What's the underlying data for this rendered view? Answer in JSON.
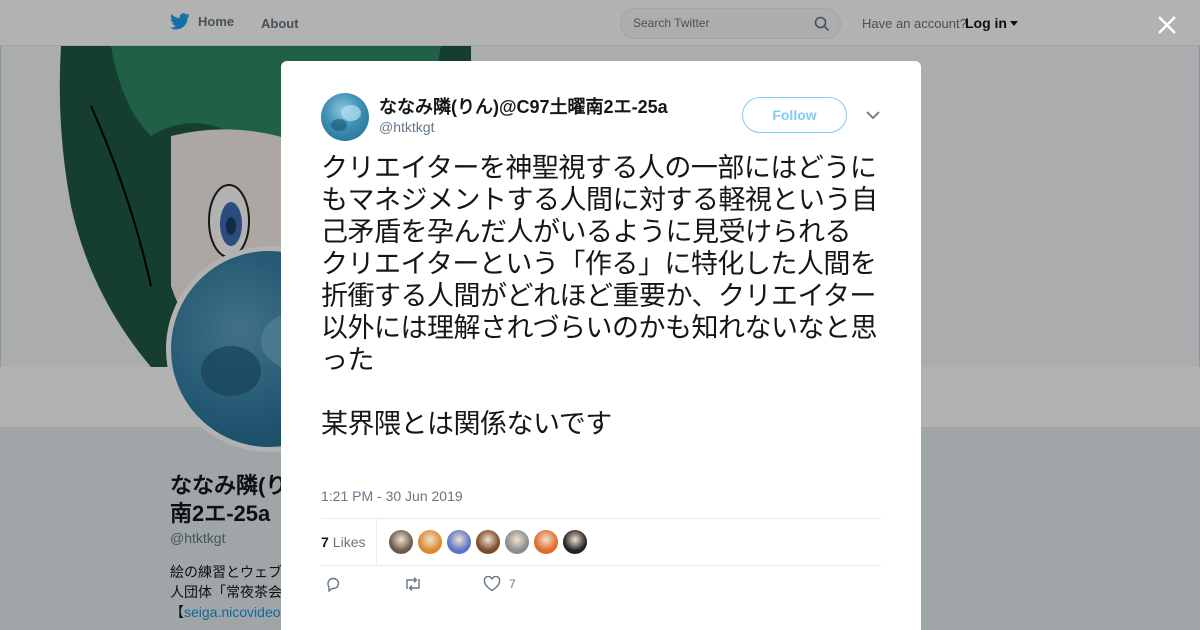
{
  "nav": {
    "home_label": "Home",
    "about_label": "About",
    "search_placeholder": "Search Twitter",
    "have_account": "Have an account?",
    "login_label": "Log in"
  },
  "profile": {
    "name_line1": "ななみ隣(り",
    "name_line2": "南2エ-25a",
    "handle": "@htktkgt",
    "bio_line1": "絵の練習とウェブ",
    "bio_line2": "人団体「常夜茶会",
    "bio_link_prefix": "【",
    "bio_link": "seiga.nicovideo"
  },
  "tweet": {
    "author_name": "ななみ隣(りん)@C97土曜南2エ-25a",
    "author_handle": "@htktkgt",
    "follow_label": "Follow",
    "text": "クリエイターを神聖視する人の一部にはどうにもマネジメントする人間に対する軽視という自己矛盾を孕んだ人がいるように見受けられる\nクリエイターという「作る」に特化した人間を折衝する人間がどれほど重要か、クリエイター以外には理解されづらいのかも知れないなと思った\n\n某界隈とは関係ないです",
    "timestamp": "1:21 PM - 30 Jun 2019",
    "likes_count": "7",
    "likes_label": "Likes",
    "like_action_count": "7"
  },
  "colors": {
    "brand": "#1da1f2",
    "like_avatars": [
      "#6b5a4a",
      "#d9892f",
      "#5a74c8",
      "#7a4a2a",
      "#8c8c8c",
      "#e06a2a",
      "#222222"
    ]
  }
}
